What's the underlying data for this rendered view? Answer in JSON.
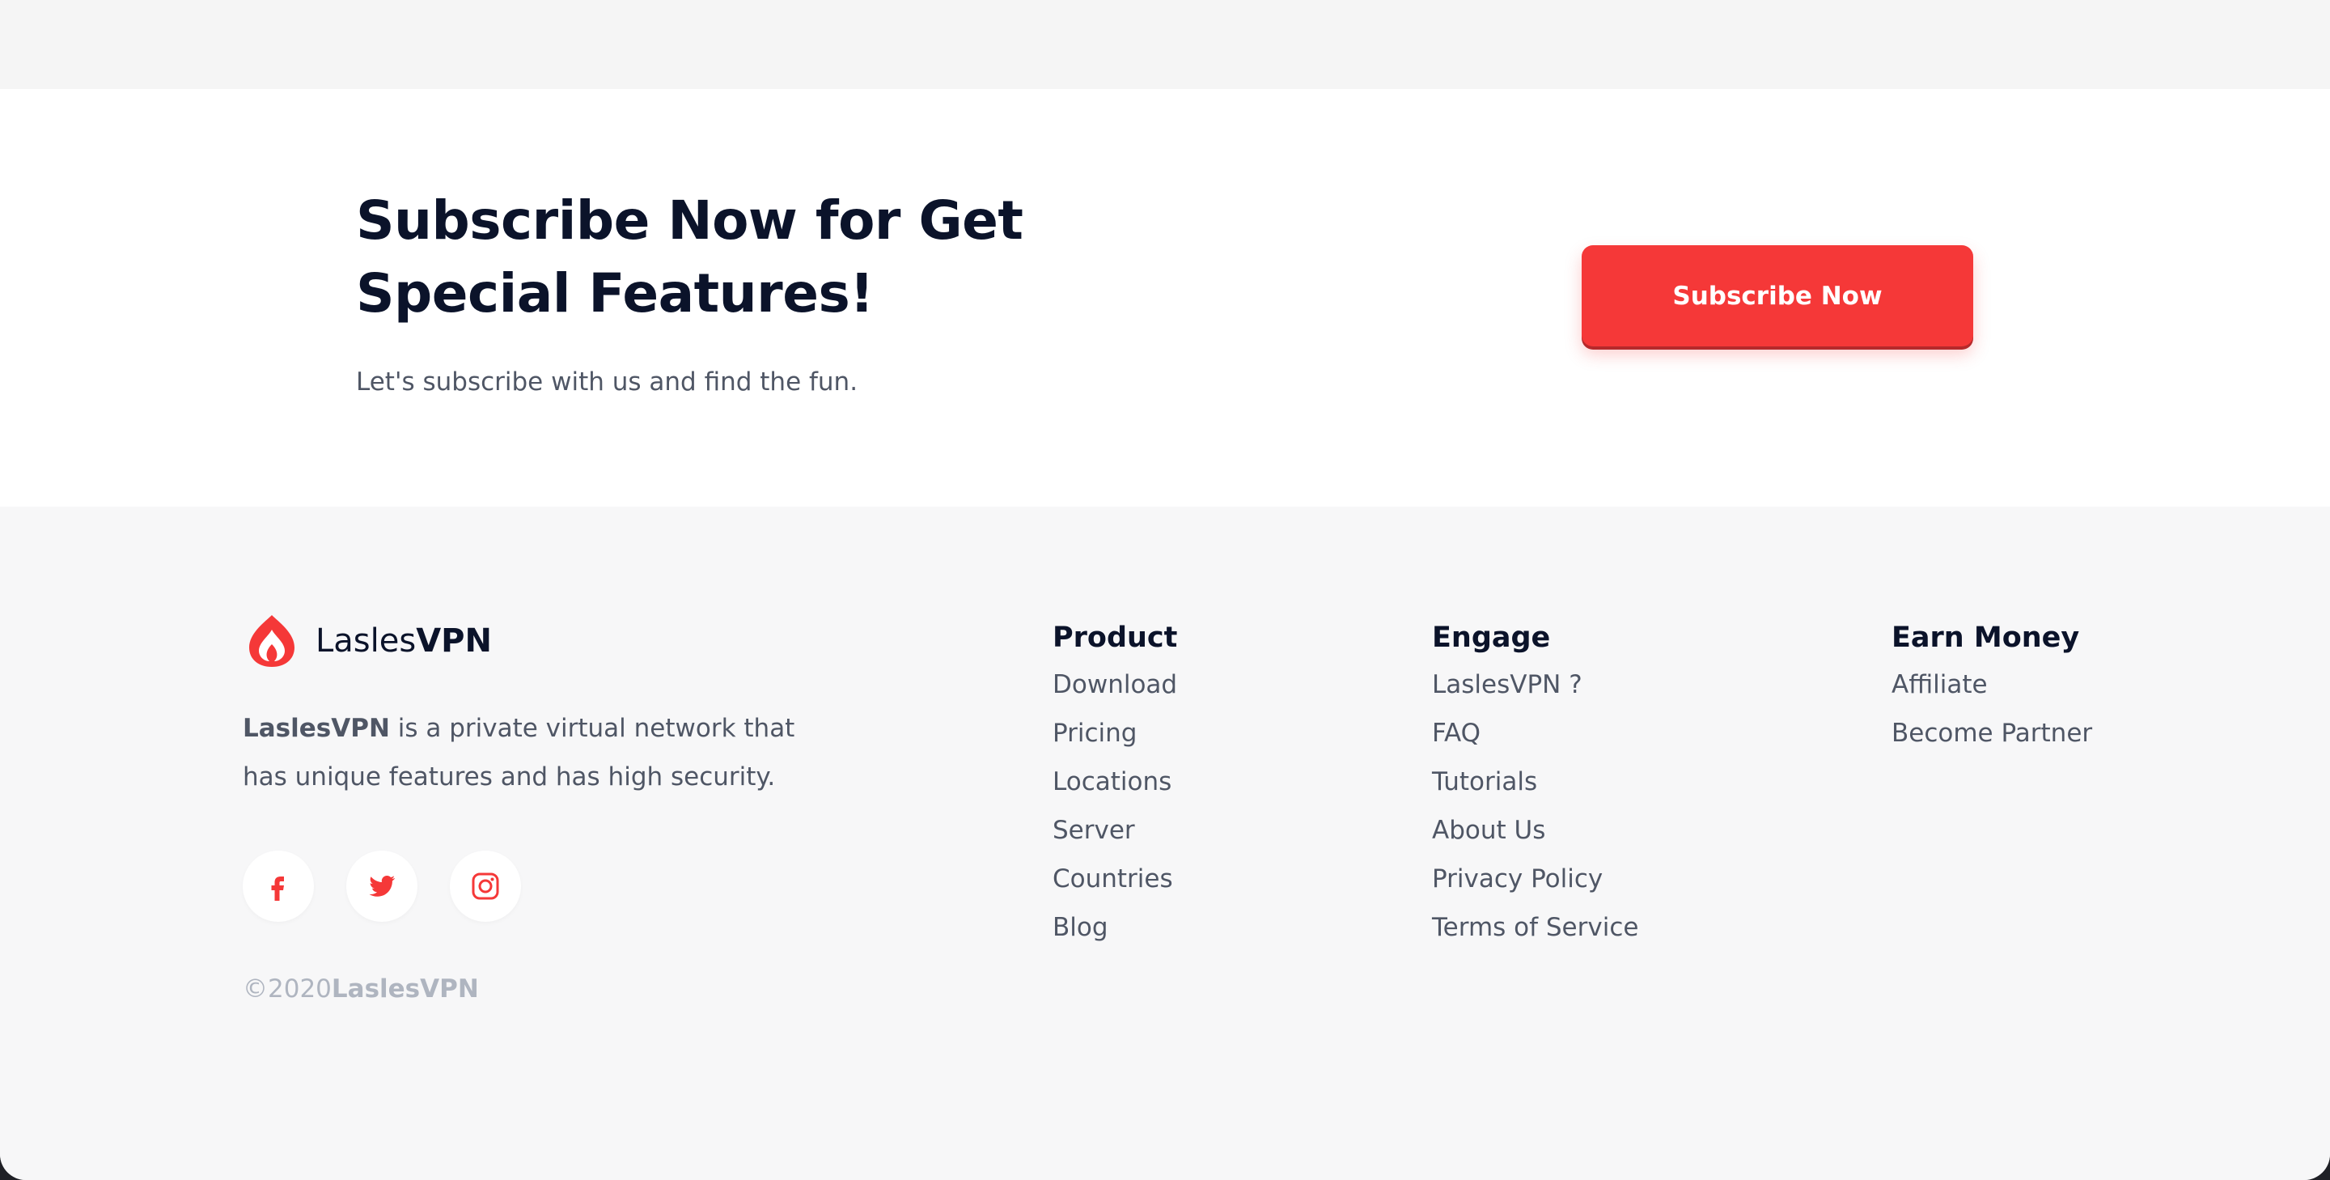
{
  "subscribe": {
    "title_line1": "Subscribe Now for Get",
    "title_line2": "Special Features!",
    "text": "Let's subscribe with us and find the fun.",
    "button_label": "Subscribe Now"
  },
  "footer": {
    "brand": {
      "name_regular": "Lasles",
      "name_bold": "VPN",
      "logo_icon": "flame-logo-icon"
    },
    "about": {
      "brand_bold": "LaslesVPN",
      "text": " is a private virtual network that has unique features and has high security."
    },
    "socials": [
      {
        "name": "facebook",
        "icon": "facebook-icon"
      },
      {
        "name": "twitter",
        "icon": "twitter-icon"
      },
      {
        "name": "instagram",
        "icon": "instagram-icon"
      }
    ],
    "copyright": {
      "prefix": "©2020",
      "brand": "LaslesVPN"
    },
    "columns": {
      "product": {
        "heading": "Product",
        "items": [
          "Download",
          "Pricing",
          "Locations",
          "Server",
          "Countries",
          "Blog"
        ]
      },
      "engage": {
        "heading": "Engage",
        "items": [
          "LaslesVPN ?",
          "FAQ",
          "Tutorials",
          "About Us",
          "Privacy Policy",
          "Terms of Service"
        ]
      },
      "earn": {
        "heading": "Earn Money",
        "items": [
          "Affiliate",
          "Become Partner"
        ]
      }
    }
  },
  "colors": {
    "accent": "#f53838",
    "heading": "#0b132a",
    "body_text": "#4f5665",
    "muted": "#afb5c0"
  }
}
